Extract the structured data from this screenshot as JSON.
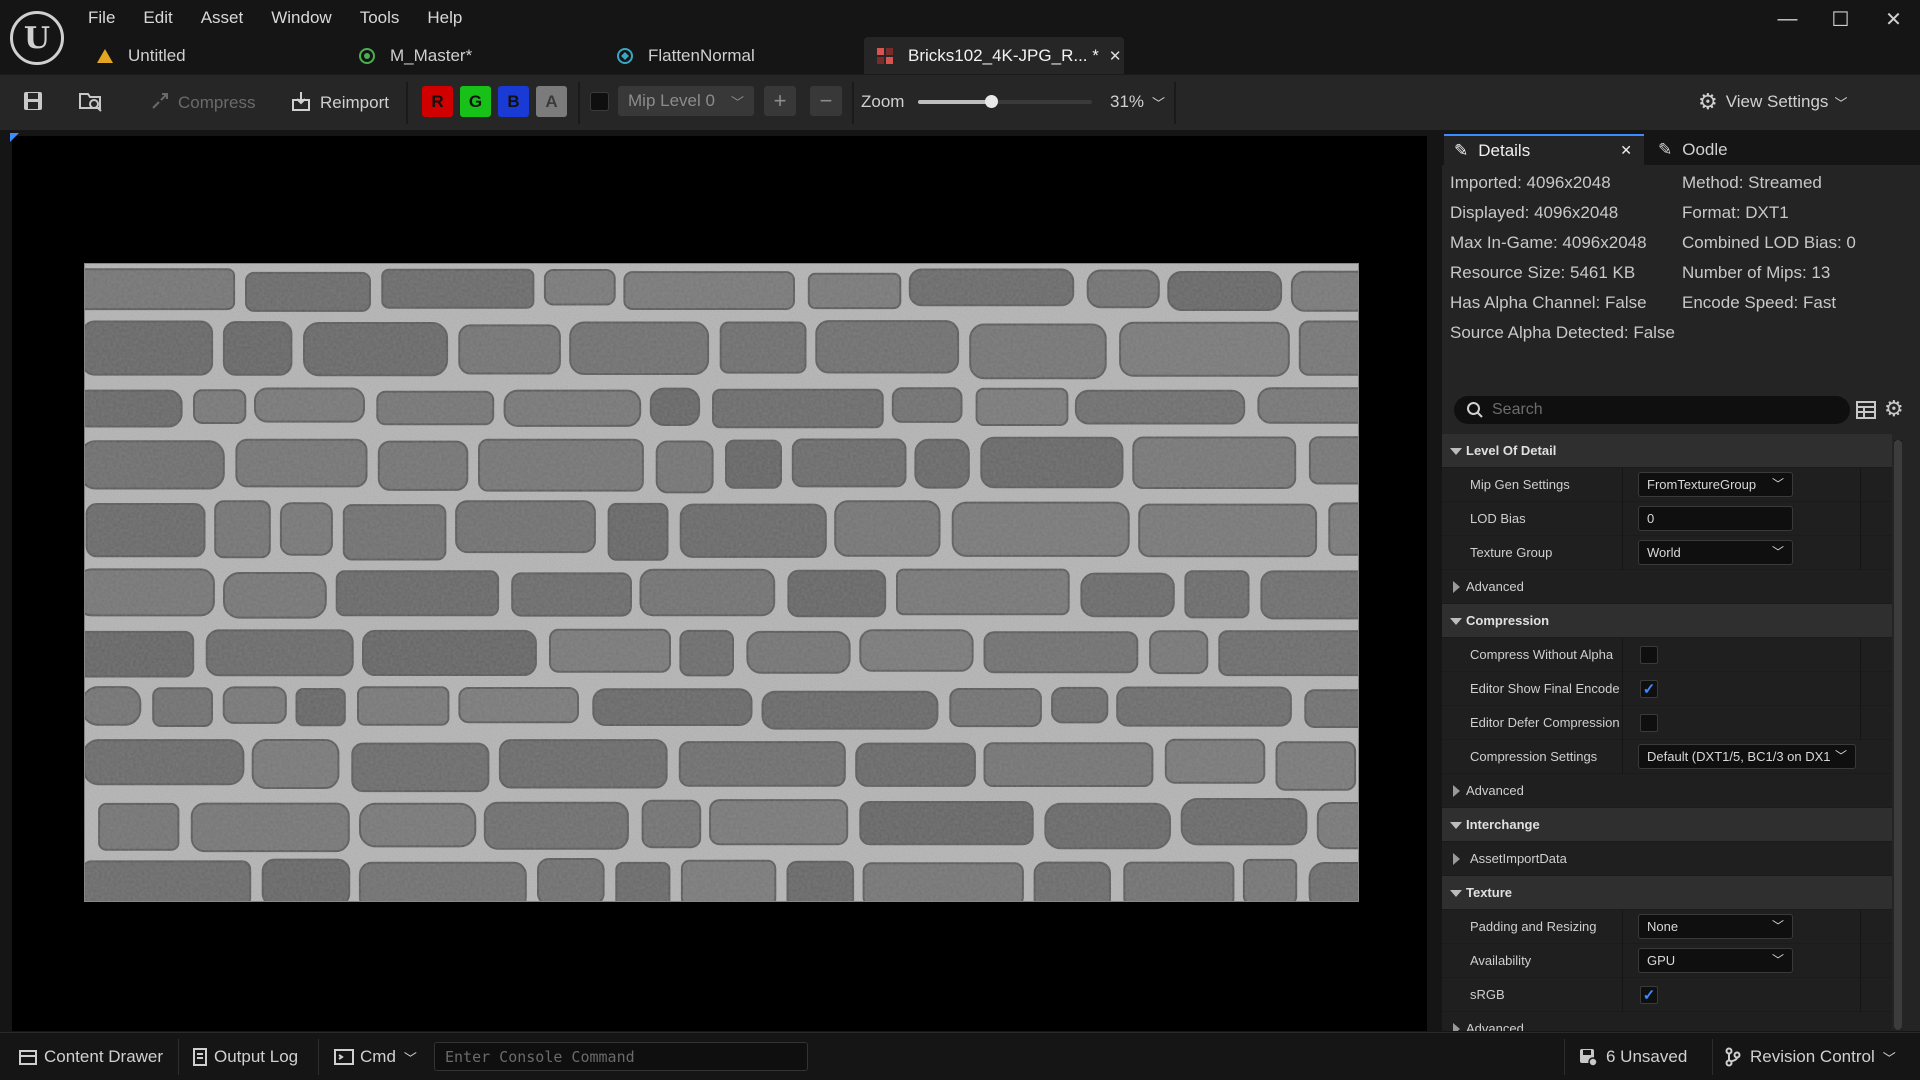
{
  "app": {
    "logo_letter": "U"
  },
  "menu": [
    "File",
    "Edit",
    "Asset",
    "Window",
    "Tools",
    "Help"
  ],
  "doc_tabs": [
    {
      "label": "Untitled",
      "icon": "warning-level-icon"
    },
    {
      "label": "M_Master*",
      "icon": "material-icon"
    },
    {
      "label": "FlattenNormal",
      "icon": "material-function-icon"
    },
    {
      "label": "Bricks102_4K-JPG_R... *",
      "icon": "texture-icon",
      "active": true
    }
  ],
  "window_controls": {
    "minimize": "—",
    "maximize": "☐",
    "close": "✕"
  },
  "toolbar": {
    "compress_label": "Compress",
    "reimport_label": "Reimport",
    "channels": [
      "R",
      "G",
      "B",
      "A"
    ],
    "mip_level": "Mip Level 0",
    "zoom_label": "Zoom",
    "zoom_value": "31%",
    "zoom_fraction": 0.42,
    "view_settings_label": "View Settings"
  },
  "panel_tabs": {
    "details": "Details",
    "oodle": "Oodle"
  },
  "stats": {
    "imported": "Imported: 4096x2048",
    "displayed": "Displayed: 4096x2048",
    "max_in_game": "Max In-Game: 4096x2048",
    "resource_size": "Resource Size: 5461 KB",
    "has_alpha": "Has Alpha Channel: False",
    "source_alpha": "Source Alpha Detected: False",
    "method": "Method: Streamed",
    "format": "Format: DXT1",
    "combined_lod": "Combined LOD Bias: 0",
    "num_mips": "Number of Mips: 13",
    "encode_speed": "Encode Speed: Fast"
  },
  "search": {
    "placeholder": "Search"
  },
  "properties": {
    "lod_category": "Level Of Detail",
    "mip_gen_label": "Mip Gen Settings",
    "mip_gen_value": "FromTextureGroup",
    "lod_bias_label": "LOD Bias",
    "lod_bias_value": "0",
    "texture_group_label": "Texture Group",
    "texture_group_value": "World",
    "advanced_label": "Advanced",
    "compression_category": "Compression",
    "compress_without_alpha_label": "Compress Without Alpha",
    "compress_without_alpha": false,
    "editor_show_final_label": "Editor Show Final Encode",
    "editor_show_final": true,
    "editor_defer_label": "Editor Defer Compression",
    "editor_defer": false,
    "compression_settings_label": "Compression Settings",
    "compression_settings_value": "Default (DXT1/5, BC1/3 on DX1",
    "advanced2_label": "Advanced",
    "interchange_category": "Interchange",
    "asset_import_label": "AssetImportData",
    "texture_category": "Texture",
    "padding_label": "Padding and Resizing",
    "padding_value": "None",
    "availability_label": "Availability",
    "availability_value": "GPU",
    "srgb_label": "sRGB",
    "srgb": true,
    "advanced3_label": "Advanced"
  },
  "statusbar": {
    "content_drawer": "Content Drawer",
    "output_log": "Output Log",
    "cmd": "Cmd",
    "console_placeholder": "Enter Console Command",
    "unsaved": "6 Unsaved",
    "revision_control": "Revision Control"
  }
}
